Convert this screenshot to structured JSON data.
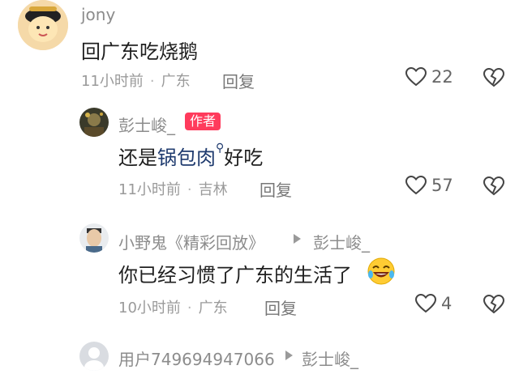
{
  "comments": [
    {
      "username": "jony",
      "text": "回广东吃烧鹅",
      "time": "11小时前",
      "location": "广东",
      "reply_label": "回复",
      "likes": "22"
    },
    {
      "username": "彭士峻_",
      "badge": "作者",
      "text_before": "还是",
      "text_link": "锅包肉",
      "text_after": "好吃",
      "time": "11小时前",
      "location": "吉林",
      "reply_label": "回复",
      "likes": "57"
    },
    {
      "username": "小野鬼《精彩回放》",
      "reply_to": "彭士峻_",
      "text": "你已经习惯了广东的生活了",
      "time": "10小时前",
      "location": "广东",
      "reply_label": "回复",
      "likes": "4"
    },
    {
      "username": "用户749694947066",
      "reply_to": "彭士峻_"
    }
  ],
  "colors": {
    "badge": "#ff3b5c",
    "link": "#1e3a6e",
    "meta": "#9a9a9a"
  }
}
